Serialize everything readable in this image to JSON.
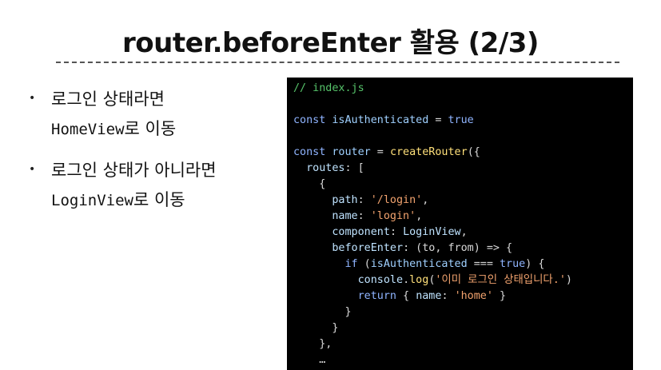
{
  "slide": {
    "title": "router.beforeEnter 활용 (2/3)"
  },
  "bullets": [
    {
      "line1": "로그인 상태라면",
      "line2_code": "HomeView",
      "line2_text": "로 이동"
    },
    {
      "line1": "로그인 상태가 아니라면",
      "line2_code": "LoginView",
      "line2_text": "로 이동"
    }
  ],
  "code": {
    "comment": "// index.js",
    "const_kw": "const",
    "isAuth_var": "isAuthenticated",
    "eq": " = ",
    "true_val": "true",
    "router_var": "router",
    "createRouter_fn": "createRouter",
    "open_paren_brace": "({",
    "routes_key": "routes",
    "colon_bracket": ": [",
    "obj_open": "{",
    "path_key": "path",
    "path_val": "'/login'",
    "name_key": "name",
    "name_val": "'login'",
    "component_key": "component",
    "component_val": "LoginView",
    "beforeEnter_key": "beforeEnter",
    "beforeEnter_args": ": (to, from) => {",
    "if_kw": "if",
    "if_open": " (",
    "if_var": "isAuthenticated",
    "if_op": " === ",
    "if_true": "true",
    "if_close": ") {",
    "console_obj": "console",
    "log_fn": "log",
    "log_arg": "'이미 로그인 상태입니다.'",
    "log_close": ")",
    "return_kw": "return",
    "return_open": " { ",
    "return_name_key": "name",
    "return_name_val": "'home'",
    "return_close": " }",
    "close_brace": "}",
    "close_brace_comma": "},",
    "ellipsis": "…"
  }
}
